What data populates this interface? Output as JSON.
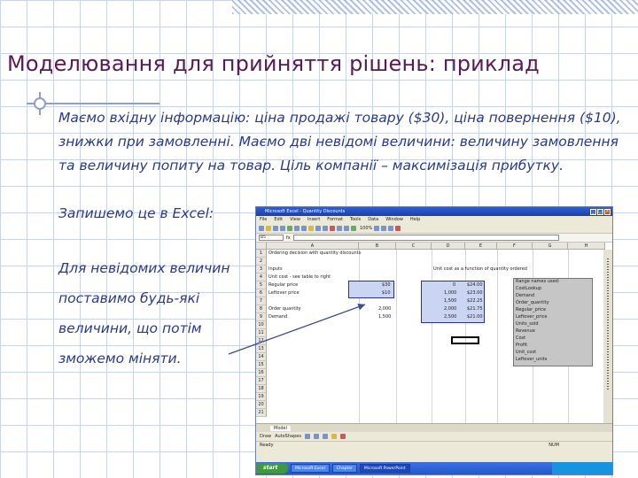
{
  "slide": {
    "title": "Моделювання для прийняття рішень: приклад",
    "paragraph1": "Маємо вхідну інформацію: ціна продажі товару ($30), ціна повернення ($10), знижки при замовленні. Маємо дві невідомі величини: величину замовлення та величину попиту на товар. Ціль компанії – максимізація прибутку.",
    "line_excel": "Запишемо це в Excel:",
    "note_lines": [
      "Для невідомих величин",
      "поставимо будь-які",
      "величини, що потім",
      "зможемо міняти."
    ]
  },
  "excel": {
    "window_title": "Microsoft Excel - Quantity Discounts",
    "menu": [
      "File",
      "Edit",
      "View",
      "Insert",
      "Format",
      "Tools",
      "Data",
      "Window",
      "Help"
    ],
    "zoom": "100%",
    "name_box": "B5",
    "columns": [
      "A",
      "B",
      "C",
      "D",
      "E",
      "F",
      "G",
      "H"
    ],
    "rows": [
      "1",
      "2",
      "3",
      "4",
      "5",
      "6",
      "7",
      "8",
      "9",
      "10",
      "11",
      "12",
      "13",
      "14",
      "15",
      "16",
      "17",
      "18",
      "19",
      "20",
      "21"
    ],
    "cells": {
      "a1": "Ordering decision with quantity discounts",
      "a3": "Inputs",
      "a4": "Unit cost - see table to right",
      "a5": "Regular price",
      "a6": "Leftover price",
      "a8": "Order quantity",
      "a9": "Demand",
      "b5": "$30",
      "b6": "$10",
      "b8": "2,000",
      "b9": "1,500",
      "d3": "Unit cost as a function of quantity ordered",
      "d4": "0",
      "d5": "1,000",
      "d6": "1,500",
      "d7": "2,000",
      "d8": "2,500",
      "e4": "$24.00",
      "e5": "$23.00",
      "e6": "$22.25",
      "e7": "$21.75",
      "e8": "$21.00"
    },
    "range_names": {
      "header": "Range names used:",
      "items": [
        "CostLookup",
        "Demand",
        "Order_quantity",
        "Regular_price",
        "Leftover_price",
        "Units_sold",
        "Revenue",
        "Cost",
        "Profit",
        "Unit_cost",
        "Leftover_units"
      ]
    },
    "sheet_tabs": [
      "Model"
    ],
    "draw_label": "Draw",
    "autoshapes_label": "AutoShapes",
    "status_left": "Ready",
    "status_right": "NUM",
    "taskbar": {
      "start": "start",
      "tasks": [
        "Microsoft Excel",
        "Chapter",
        "Microsoft PowerPoint"
      ]
    }
  },
  "colors": {
    "title": "#5a1a55",
    "body": "#2a3a8c",
    "grid": "#c9d3ea",
    "highlight": "#cad4f3"
  }
}
